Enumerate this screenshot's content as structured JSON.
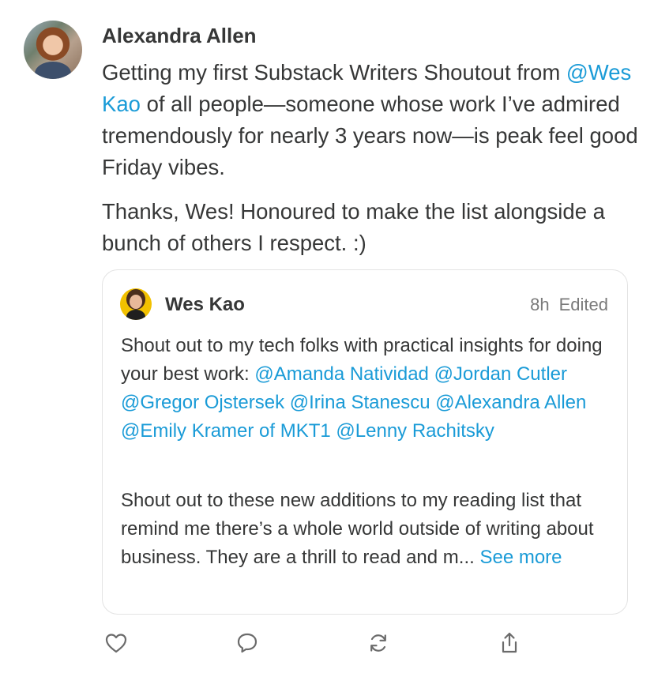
{
  "post": {
    "author": "Alexandra Allen",
    "body": {
      "p1_a": "Getting my first Substack Writers Shoutout from ",
      "p1_mention": "@Wes Kao",
      "p1_b": " of all people—someone whose work I’ve admired tremendously for nearly 3 years now—is peak feel good Friday vibes.",
      "p2": "Thanks, Wes! Honoured to make the list alongside a bunch of others I respect. :)"
    }
  },
  "quoted": {
    "author": "Wes Kao",
    "time": "8h",
    "edited": "Edited",
    "p1_intro": "Shout out to my tech folks with practical insights for doing your best work: ",
    "mentions": [
      "@Amanda Natividad",
      "@Jordan Cutler",
      "@Gregor Ojstersek",
      "@Irina Stanescu",
      "@Alexandra Allen",
      "@Emily Kramer of MKT1",
      "@Lenny Rachitsky"
    ],
    "p2": "Shout out to these new additions to my reading list that remind me there’s a whole world outside of writing about business. They are a thrill to read and m...",
    "see_more": "See more"
  },
  "actions": {
    "icons": [
      "heart-icon",
      "comment-icon",
      "restack-icon",
      "share-icon"
    ]
  }
}
